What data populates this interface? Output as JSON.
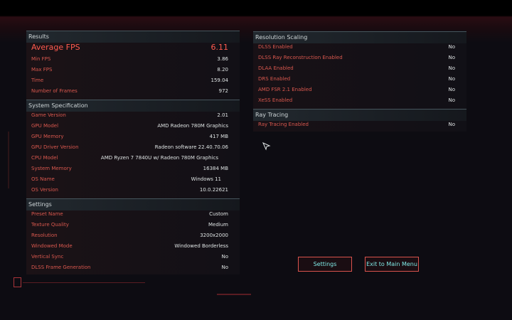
{
  "results": {
    "header": "Results",
    "avg_fps_label": "Average FPS",
    "avg_fps_value": "6.11",
    "rows": [
      {
        "label": "Min FPS",
        "value": "3.86"
      },
      {
        "label": "Max FPS",
        "value": "8.20"
      },
      {
        "label": "Time",
        "value": "159.04"
      },
      {
        "label": "Number of Frames",
        "value": "972"
      }
    ]
  },
  "system": {
    "header": "System Specification",
    "rows": [
      {
        "label": "Game Version",
        "value": "2.01"
      },
      {
        "label": "GPU Model",
        "value": "AMD Radeon 780M Graphics"
      },
      {
        "label": "GPU Memory",
        "value": "417 MB"
      },
      {
        "label": "GPU Driver Version",
        "value": "Radeon software 22.40.70.06"
      },
      {
        "label": "CPU Model",
        "value": "AMD Ryzen 7 7840U w/ Radeon 780M Graphics"
      },
      {
        "label": "System Memory",
        "value": "16384 MB"
      },
      {
        "label": "OS Name",
        "value": "Windows 11"
      },
      {
        "label": "OS Version",
        "value": "10.0.22621"
      }
    ]
  },
  "settings": {
    "header": "Settings",
    "rows": [
      {
        "label": "Preset Name",
        "value": "Custom"
      },
      {
        "label": "Texture Quality",
        "value": "Medium"
      },
      {
        "label": "Resolution",
        "value": "3200x2000"
      },
      {
        "label": "Windowed Mode",
        "value": "Windowed Borderless"
      },
      {
        "label": "Vertical Sync",
        "value": "No"
      },
      {
        "label": "DLSS Frame Generation",
        "value": "No"
      }
    ]
  },
  "resolution_scaling": {
    "header": "Resolution Scaling",
    "rows": [
      {
        "label": "DLSS Enabled",
        "value": "No"
      },
      {
        "label": "DLSS Ray Reconstruction Enabled",
        "value": "No"
      },
      {
        "label": "DLAA Enabled",
        "value": "No"
      },
      {
        "label": "DRS Enabled",
        "value": "No"
      },
      {
        "label": "AMD FSR 2.1 Enabled",
        "value": "No"
      },
      {
        "label": "XeSS Enabled",
        "value": "No"
      }
    ]
  },
  "ray_tracing": {
    "header": "Ray Tracing",
    "rows": [
      {
        "label": "Ray Tracing Enabled",
        "value": "No"
      }
    ]
  },
  "buttons": {
    "settings": "Settings",
    "exit": "Exit to Main Menu"
  },
  "colors": {
    "accent_red": "#ff5b4f",
    "label_red": "#d9584e",
    "button_cyan": "#7fe8e4"
  }
}
